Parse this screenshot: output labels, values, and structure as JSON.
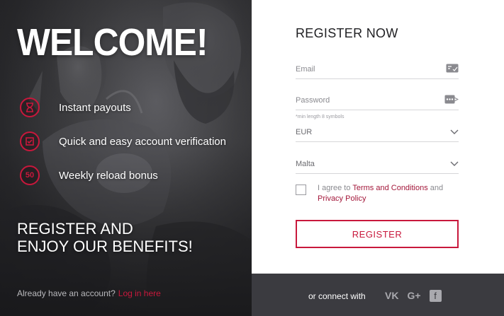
{
  "promo": {
    "title": "WELCOME!",
    "benefits": [
      {
        "icon": "hourglass-icon",
        "label": "Instant payouts"
      },
      {
        "icon": "verification-icon",
        "label": "Quick and easy account verification"
      },
      {
        "icon": "bonus-50-icon",
        "badge": "50",
        "label": "Weekly reload bonus"
      }
    ],
    "cta_line1": "REGISTER AND",
    "cta_line2": "ENJOY OUR BENEFITS!",
    "login_prompt": "Already have an account?",
    "login_link": "Log in here"
  },
  "form": {
    "title": "REGISTER NOW",
    "email_placeholder": "Email",
    "password_placeholder": "Password",
    "password_hint": "*min length 8 symbols",
    "currency_value": "EUR",
    "country_value": "Malta",
    "agree_prefix": "I agree to",
    "terms_link": "Terms and Conditions",
    "agree_and": "and",
    "privacy_link": "Privacy Policy",
    "register_label": "REGISTER"
  },
  "social": {
    "label": "or connect with",
    "providers": [
      "vk-icon",
      "google-plus-icon",
      "facebook-icon"
    ],
    "vk_glyph": "VK",
    "google_glyph": "G+",
    "facebook_glyph": "f"
  },
  "colors": {
    "accent": "#c8183c",
    "social_bar": "#3b3b40",
    "promo_bg": "#2c2c2f"
  }
}
